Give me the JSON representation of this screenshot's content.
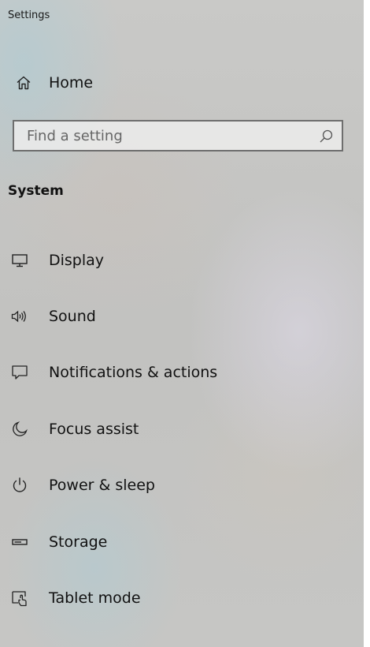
{
  "window": {
    "title": "Settings"
  },
  "home": {
    "label": "Home",
    "icon": "home-icon"
  },
  "search": {
    "placeholder": "Find a setting",
    "value": "",
    "icon": "search-icon"
  },
  "section": {
    "title": "System"
  },
  "nav": {
    "items": [
      {
        "label": "Display",
        "icon": "monitor-icon"
      },
      {
        "label": "Sound",
        "icon": "speaker-icon"
      },
      {
        "label": "Notifications & actions",
        "icon": "notifications-icon"
      },
      {
        "label": "Focus assist",
        "icon": "moon-icon"
      },
      {
        "label": "Power & sleep",
        "icon": "power-icon"
      },
      {
        "label": "Storage",
        "icon": "storage-icon"
      },
      {
        "label": "Tablet mode",
        "icon": "tablet-mode-icon"
      }
    ]
  },
  "colors": {
    "text": "#111111",
    "search_border": "#6e6e6e",
    "background": "#c4c4c2"
  }
}
